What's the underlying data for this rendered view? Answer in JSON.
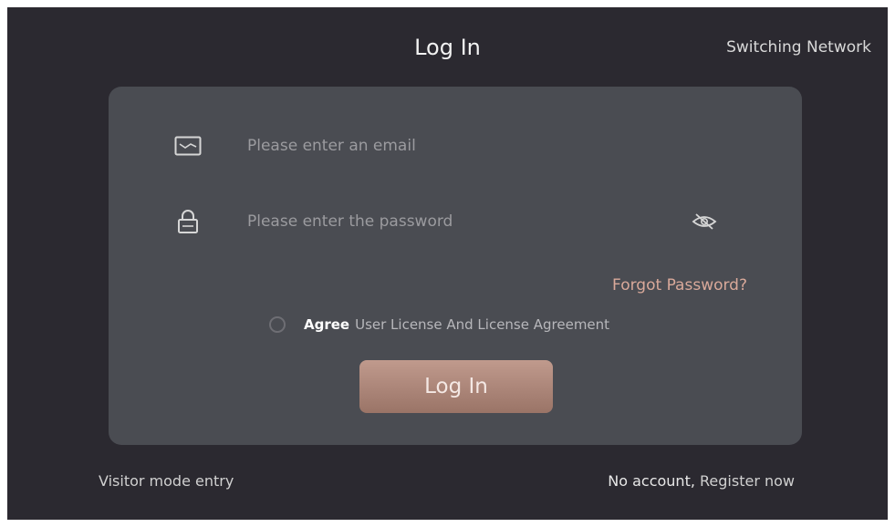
{
  "header": {
    "title": "Log In",
    "switch_network": "Switching Network"
  },
  "form": {
    "email_placeholder": "Please enter an email",
    "email_value": "",
    "password_placeholder": "Please enter the password",
    "password_value": "",
    "forgot_password": "Forgot Password?",
    "agree_label": "Agree",
    "agreement_link": "User License And License Agreement",
    "agree_checked": false,
    "login_button": "Log In"
  },
  "footer": {
    "visitor_mode": "Visitor mode entry",
    "no_account": "No account,",
    "register_now": "Register now"
  },
  "icons": {
    "email": "mail-icon",
    "password": "lock-icon",
    "toggle_visibility": "eye-closed-icon"
  },
  "colors": {
    "background": "#2b2930",
    "card": "#4a4c52",
    "accent": "#b08a7d",
    "forgot_link": "#d9a99a"
  }
}
